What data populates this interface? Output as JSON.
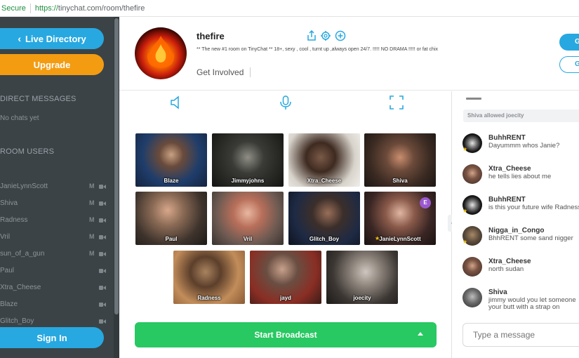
{
  "browser": {
    "secure_label": "Secure",
    "url_proto": "https://",
    "url_rest": "tinychat.com/room/thefire"
  },
  "sidebar": {
    "live_directory": "Live Directory",
    "upgrade": "Upgrade",
    "direct_messages_heading": "DIRECT MESSAGES",
    "no_chats": "No chats yet",
    "room_users_heading": "ROOM USERS",
    "users": [
      {
        "name": "JanieLynnScott",
        "mod": "M"
      },
      {
        "name": "Shiva",
        "mod": "M"
      },
      {
        "name": "Radness",
        "mod": "M"
      },
      {
        "name": "Vril",
        "mod": "M"
      },
      {
        "name": "sun_of_a_gun",
        "mod": "M"
      },
      {
        "name": "Paul",
        "mod": ""
      },
      {
        "name": "Xtra_Cheese",
        "mod": ""
      },
      {
        "name": "Blaze",
        "mod": ""
      },
      {
        "name": "Glitch_Boy",
        "mod": ""
      }
    ],
    "sign_in": "Sign In"
  },
  "room": {
    "name": "thefire",
    "description": "** The new #1 room on TinyChat ** 18+, sexy , cool , turnt up ,always open 24/7. !!!!! NO DRAMA !!!!! or fat chix",
    "get_involved": "Get Involved",
    "btn_primary_letter": "G",
    "btn_secondary_letter": "G"
  },
  "videos": [
    {
      "name": "Blaze"
    },
    {
      "name": "Jimmyjohns"
    },
    {
      "name": "Xtra_Cheese"
    },
    {
      "name": "Shiva"
    },
    {
      "name": "Paul"
    },
    {
      "name": "Vril"
    },
    {
      "name": "Glitch_Boy"
    },
    {
      "name": "JanieLynnScott",
      "badge": "E"
    },
    {
      "name": "Radness"
    },
    {
      "name": "jayd"
    },
    {
      "name": "joecity"
    }
  ],
  "broadcast_label": "Start Broadcast",
  "chat": {
    "system_message": "Shiva allowed joecity",
    "messages": [
      {
        "user": "BuhhRENT",
        "line1": "Dayummm whos Janie?",
        "line2": ""
      },
      {
        "user": "Xtra_Cheese",
        "line1": "he tells lies about me",
        "line2": ""
      },
      {
        "user": "BuhhRENT",
        "line1": "is this your future wife Radness",
        "line2": ""
      },
      {
        "user": "Nigga_in_Congo",
        "line1": "BhhRENT some sand nigger",
        "line2": ""
      },
      {
        "user": "Xtra_Cheese",
        "line1": "north sudan",
        "line2": ""
      },
      {
        "user": "Shiva",
        "line1": "jimmy would you let someone",
        "line2": "your butt with a strap on"
      }
    ],
    "input_placeholder": "Type a message"
  },
  "colors": {
    "accent_blue": "#27a8e0",
    "upgrade_orange": "#f39c12",
    "broadcast_green": "#28c862",
    "sidebar_bg": "#3b4347"
  }
}
